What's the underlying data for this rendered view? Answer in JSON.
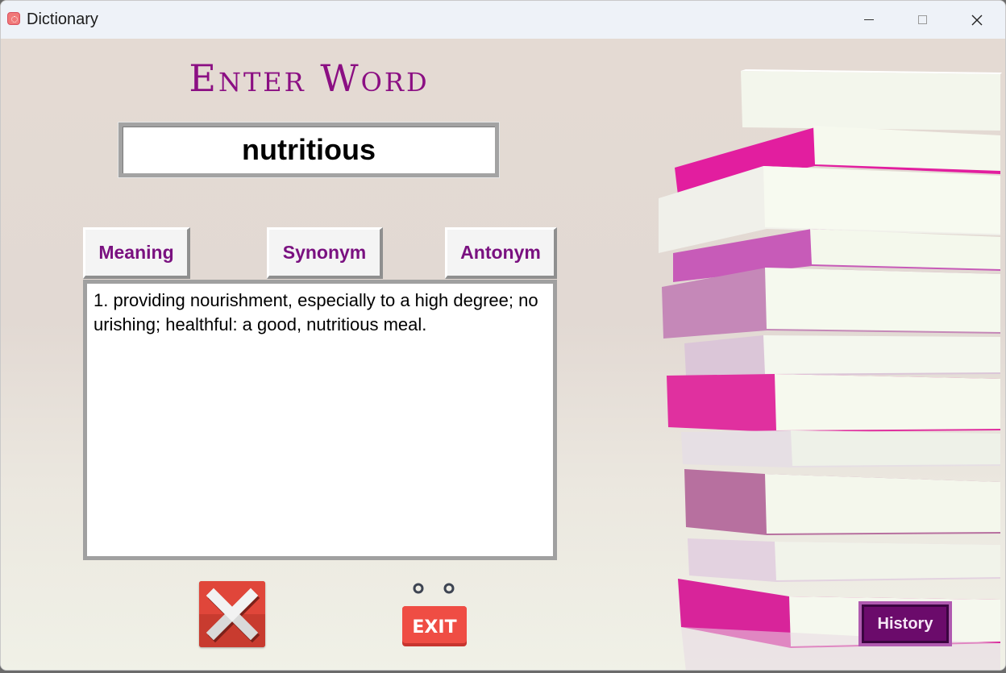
{
  "window": {
    "title": "Dictionary",
    "controls": [
      "minimize",
      "maximize",
      "close"
    ]
  },
  "heading": "Enter Word",
  "search": {
    "value": "nutritious"
  },
  "buttons": {
    "meaning": "Meaning",
    "synonym": "Synonym",
    "antonym": "Antonym",
    "exit": "EXIT",
    "history": "History"
  },
  "result": {
    "text": "1. providing nourishment, especially to a high degree; nourishing; healthful: a good, nutritious meal."
  },
  "icons": {
    "clear": "clear-x-icon",
    "exit": "exit-sign-icon",
    "app": "dictionary-app-icon"
  },
  "colors": {
    "accent": "#8b0f83",
    "button_text": "#7a1180",
    "history_bg": "#6b0b6b",
    "clear_bg": "#c43a2d",
    "exit_bg": "#e8463e"
  }
}
